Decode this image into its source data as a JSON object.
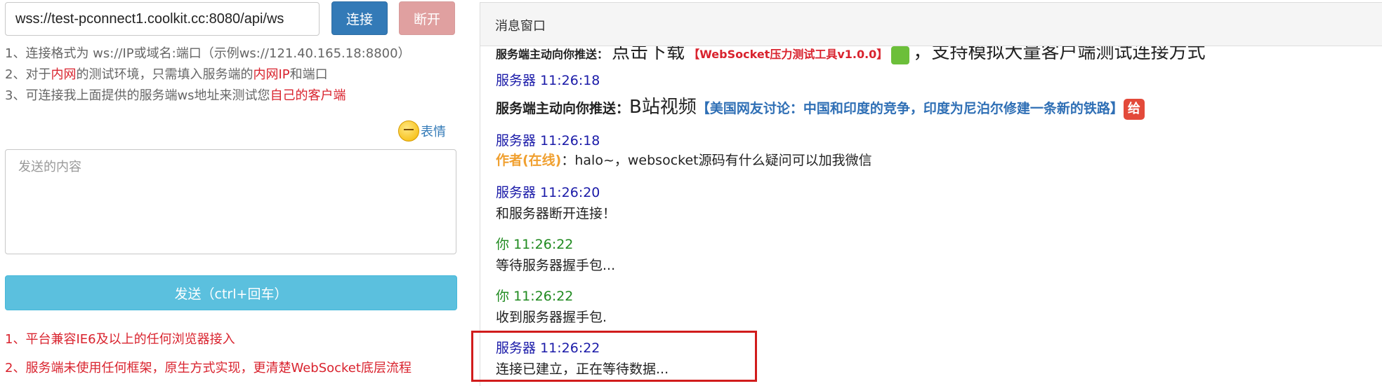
{
  "connection": {
    "url_value": "wss://test-pconnect1.coolkit.cc:8080/api/ws",
    "connect_label": "连接",
    "disconnect_label": "断开"
  },
  "tips": [
    {
      "parts": [
        {
          "text": "1、连接格式为 ws://IP或域名:端口（示例ws://121.40.165.18:8800）",
          "red": false
        }
      ]
    },
    {
      "parts": [
        {
          "text": "2、对于",
          "red": false
        },
        {
          "text": "内网",
          "red": true
        },
        {
          "text": "的测试环境，只需填入服务端的",
          "red": false
        },
        {
          "text": "内网IP",
          "red": true
        },
        {
          "text": "和端口",
          "red": false
        }
      ]
    },
    {
      "parts": [
        {
          "text": "3、可连接我上面提供的服务端ws地址来测试您",
          "red": false
        },
        {
          "text": "自己的客户端",
          "red": true
        }
      ]
    }
  ],
  "emoji_label": "表情",
  "compose": {
    "placeholder": "发送的内容",
    "send_label": "发送（ctrl+回车）"
  },
  "notes": [
    "1、平台兼容IE6及以上的任何浏览器接入",
    "2、服务端未使用任何框架，原生方式实现，更清楚WebSocket底层流程"
  ],
  "panel": {
    "title": "消息窗口",
    "partial_top": {
      "label": "服务端主动向你推送：",
      "text": "点击下载",
      "link": "【WebSocket压力测试工具v1.0.0】",
      "suffix": "，支持模拟大量客户端测试连接方式"
    },
    "messages": [
      {
        "who": "server",
        "sender": "服务器",
        "time": "11:26:18",
        "type": "push",
        "label": "服务端主动向你推送：",
        "lead": "B站视频",
        "link": "【美国网友讨论：中国和印度的竞争，印度为尼泊尔修建一条新的铁路】",
        "icon": "给"
      },
      {
        "who": "server",
        "sender": "服务器",
        "time": "11:26:18",
        "type": "author",
        "author": "作者(在线)",
        "text": "：halo~，websocket源码有什么疑问可以加我微信"
      },
      {
        "who": "server",
        "sender": "服务器",
        "time": "11:26:20",
        "type": "text",
        "text": "和服务器断开连接！"
      },
      {
        "who": "you",
        "sender": "你",
        "time": "11:26:22",
        "type": "text",
        "text": "等待服务器握手包..."
      },
      {
        "who": "you",
        "sender": "你",
        "time": "11:26:22",
        "type": "text",
        "text": "收到服务器握手包."
      },
      {
        "who": "server",
        "sender": "服务器",
        "time": "11:26:22",
        "type": "text",
        "text": "连接已建立，正在等待数据..."
      }
    ]
  },
  "colors": {
    "connect": "#337ab7",
    "disconnect": "#e0a0a0",
    "send": "#5bc0de",
    "highlight": "#d11c1c",
    "server_name": "#1a1aa8",
    "you_name": "#1f8a1f",
    "red_text": "#d9232e"
  },
  "icons": {
    "emoji": "smile-face-icon",
    "gift": "gift-badge-icon",
    "tool": "green-tool-icon"
  }
}
